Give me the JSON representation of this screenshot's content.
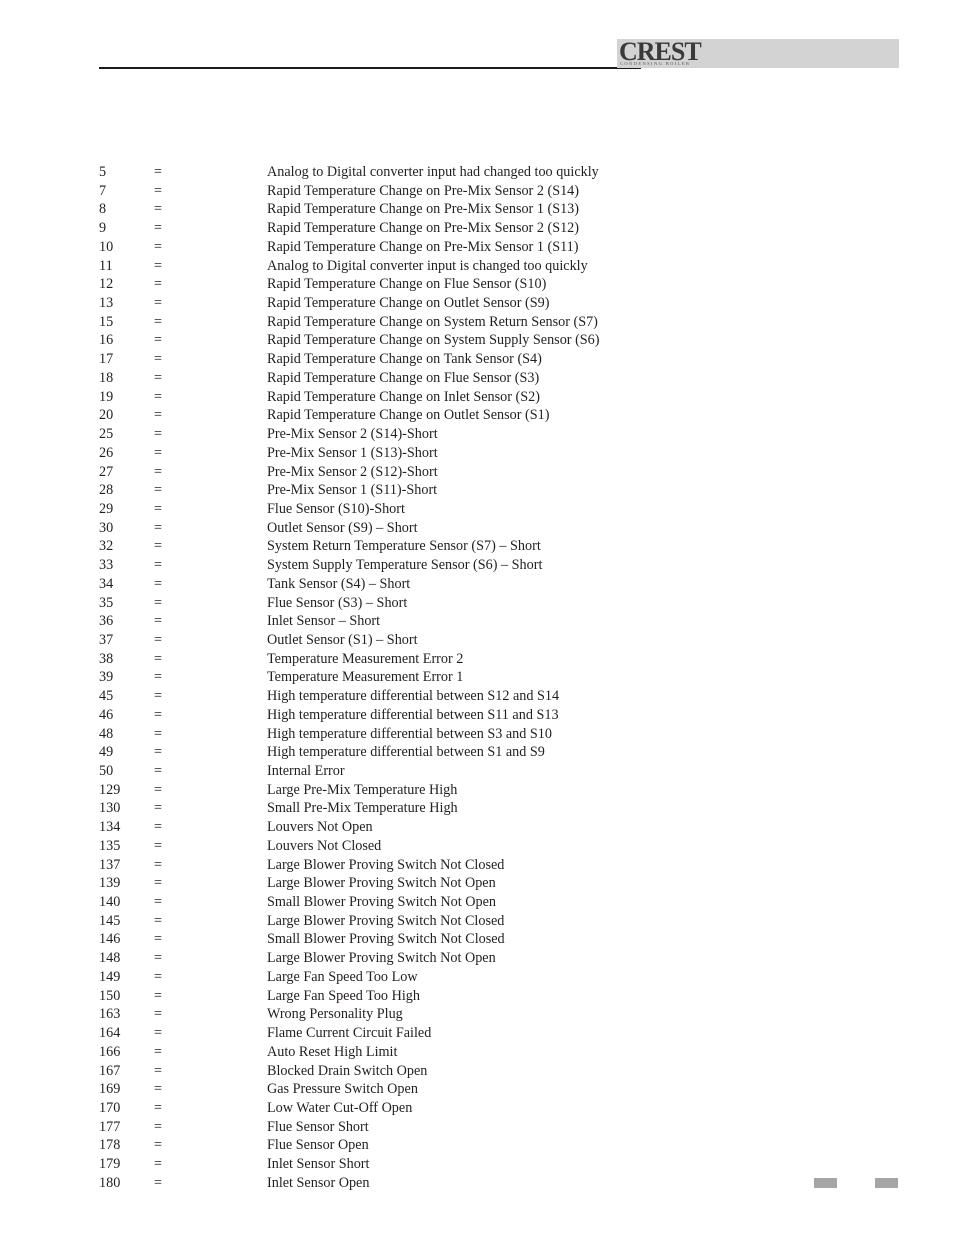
{
  "header": {
    "logo_text": "CREST",
    "logo_tagline": "CONDENSING BOILER"
  },
  "codes": [
    {
      "code": "5",
      "sep": "=",
      "description": "Analog to Digital converter input had changed too quickly"
    },
    {
      "code": "7",
      "sep": "=",
      "description": "Rapid Temperature Change on Pre-Mix Sensor 2 (S14)"
    },
    {
      "code": "8",
      "sep": "=",
      "description": "Rapid Temperature Change on Pre-Mix Sensor 1 (S13)"
    },
    {
      "code": "9",
      "sep": "=",
      "description": "Rapid Temperature Change on Pre-Mix Sensor 2 (S12)"
    },
    {
      "code": "10",
      "sep": "=",
      "description": "Rapid Temperature Change on Pre-Mix Sensor 1 (S11)"
    },
    {
      "code": "11",
      "sep": "=",
      "description": "Analog to Digital converter input is changed too quickly"
    },
    {
      "code": "12",
      "sep": "=",
      "description": "Rapid Temperature Change on Flue Sensor (S10)"
    },
    {
      "code": "13",
      "sep": "=",
      "description": "Rapid Temperature Change on Outlet Sensor (S9)"
    },
    {
      "code": "15",
      "sep": "=",
      "description": "Rapid Temperature Change on System Return Sensor (S7)"
    },
    {
      "code": "16",
      "sep": "=",
      "description": "Rapid Temperature Change on System Supply Sensor (S6)"
    },
    {
      "code": "17",
      "sep": "=",
      "description": "Rapid Temperature Change on Tank Sensor (S4)"
    },
    {
      "code": "18",
      "sep": "=",
      "description": "Rapid Temperature Change on Flue Sensor (S3)"
    },
    {
      "code": "19",
      "sep": "=",
      "description": "Rapid Temperature Change on Inlet Sensor (S2)"
    },
    {
      "code": "20",
      "sep": "=",
      "description": "Rapid Temperature Change on Outlet Sensor (S1)"
    },
    {
      "code": "25",
      "sep": "=",
      "description": "Pre-Mix Sensor 2 (S14)-Short"
    },
    {
      "code": "26",
      "sep": "=",
      "description": "Pre-Mix Sensor 1 (S13)-Short"
    },
    {
      "code": "27",
      "sep": "=",
      "description": "Pre-Mix Sensor 2 (S12)-Short"
    },
    {
      "code": "28",
      "sep": "=",
      "description": "Pre-Mix Sensor 1 (S11)-Short"
    },
    {
      "code": "29",
      "sep": "=",
      "description": "Flue Sensor (S10)-Short"
    },
    {
      "code": "30",
      "sep": "=",
      "description": "Outlet Sensor (S9) – Short"
    },
    {
      "code": "32",
      "sep": "=",
      "description": "System Return Temperature Sensor (S7) – Short"
    },
    {
      "code": "33",
      "sep": "=",
      "description": "System Supply Temperature Sensor (S6) – Short"
    },
    {
      "code": "34",
      "sep": "=",
      "description": "Tank Sensor (S4) – Short"
    },
    {
      "code": "35",
      "sep": "=",
      "description": "Flue Sensor (S3) – Short"
    },
    {
      "code": "36",
      "sep": "=",
      "description": "Inlet Sensor – Short"
    },
    {
      "code": "37",
      "sep": "=",
      "description": "Outlet Sensor (S1) – Short"
    },
    {
      "code": "38",
      "sep": "=",
      "description": "Temperature Measurement Error 2"
    },
    {
      "code": "39",
      "sep": "=",
      "description": "Temperature Measurement Error 1"
    },
    {
      "code": "45",
      "sep": "=",
      "description": "High temperature differential between S12 and S14"
    },
    {
      "code": "46",
      "sep": "=",
      "description": "High temperature differential between S11 and S13"
    },
    {
      "code": "48",
      "sep": "=",
      "description": "High temperature differential between S3 and S10"
    },
    {
      "code": "49",
      "sep": "=",
      "description": "High temperature differential between S1 and S9"
    },
    {
      "code": "50",
      "sep": "=",
      "description": "Internal Error"
    },
    {
      "code": "129",
      "sep": "=",
      "description": "Large Pre-Mix Temperature High"
    },
    {
      "code": "130",
      "sep": "=",
      "description": "Small Pre-Mix Temperature High"
    },
    {
      "code": "134",
      "sep": "=",
      "description": "Louvers Not Open"
    },
    {
      "code": "135",
      "sep": "=",
      "description": "Louvers Not Closed"
    },
    {
      "code": "137",
      "sep": "=",
      "description": "Large Blower Proving Switch Not Closed"
    },
    {
      "code": "139",
      "sep": "=",
      "description": "Large Blower Proving Switch Not Open"
    },
    {
      "code": "140",
      "sep": "=",
      "description": "Small Blower Proving Switch Not Open"
    },
    {
      "code": "145",
      "sep": "=",
      "description": "Large Blower Proving Switch Not Closed"
    },
    {
      "code": "146",
      "sep": "=",
      "description": "Small Blower Proving Switch Not Closed"
    },
    {
      "code": "148",
      "sep": "=",
      "description": "Large Blower Proving Switch Not Open"
    },
    {
      "code": "149",
      "sep": "=",
      "description": "Large Fan Speed Too Low"
    },
    {
      "code": "150",
      "sep": "=",
      "description": "Large Fan Speed Too High"
    },
    {
      "code": "163",
      "sep": "=",
      "description": "Wrong Personality Plug"
    },
    {
      "code": "164",
      "sep": "=",
      "description": "Flame Current Circuit Failed"
    },
    {
      "code": "166",
      "sep": "=",
      "description": "Auto Reset High Limit"
    },
    {
      "code": "167",
      "sep": "=",
      "description": "Blocked Drain Switch Open"
    },
    {
      "code": "169",
      "sep": "=",
      "description": "Gas Pressure Switch Open"
    },
    {
      "code": "170",
      "sep": "=",
      "description": "Low Water Cut-Off Open"
    },
    {
      "code": "177",
      "sep": "=",
      "description": "Flue Sensor Short"
    },
    {
      "code": "178",
      "sep": "=",
      "description": "Flue Sensor Open"
    },
    {
      "code": "179",
      "sep": "=",
      "description": "Inlet Sensor Short"
    },
    {
      "code": "180",
      "sep": "=",
      "description": "Inlet Sensor Open"
    }
  ]
}
